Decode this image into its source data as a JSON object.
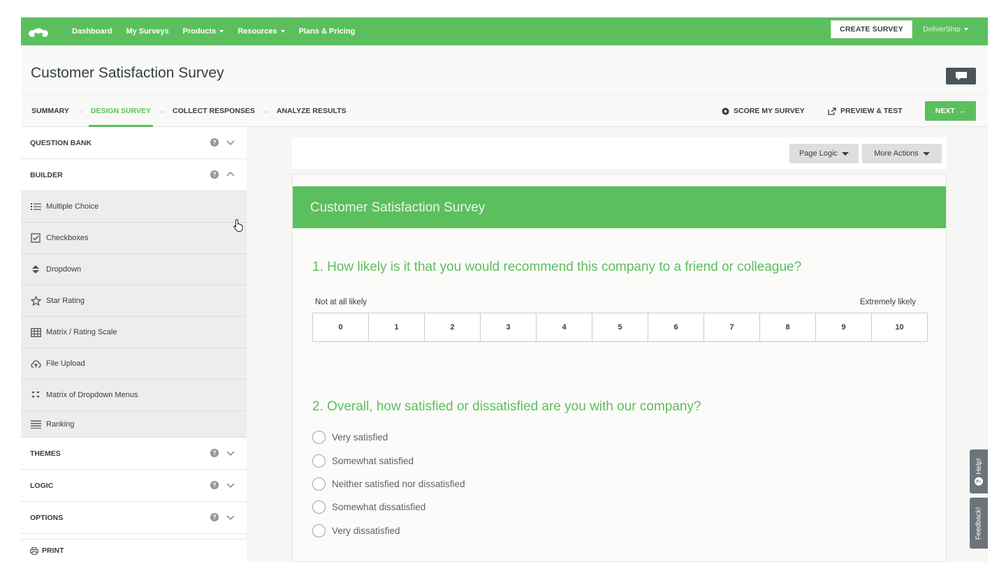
{
  "colors": {
    "brand": "#5cbf5d",
    "text": "#333e48",
    "muted": "#5a646c"
  },
  "nav": {
    "logo_icon": "surveymonkey-logo-icon",
    "links": [
      "Dashboard",
      "My Surveys",
      "Products",
      "Resources",
      "Plans & Pricing"
    ],
    "create_label": "CREATE SURVEY",
    "account": "DeliverShip"
  },
  "title": "Customer Satisfaction Survey",
  "steps": [
    "SUMMARY",
    "DESIGN SURVEY",
    "COLLECT RESPONSES",
    "ANALYZE RESULTS"
  ],
  "active_step": "DESIGN SURVEY",
  "actions": {
    "score": "SCORE MY SURVEY",
    "preview": "PREVIEW & TEST",
    "next": "NEXT"
  },
  "sidebar": {
    "question_bank": "QUESTION BANK",
    "builder": "BUILDER",
    "builder_items": [
      {
        "label": "Multiple Choice",
        "icon": "list-icon"
      },
      {
        "label": "Checkboxes",
        "icon": "checkbox-icon"
      },
      {
        "label": "Dropdown",
        "icon": "dropdown-icon"
      },
      {
        "label": "Star Rating",
        "icon": "star-icon"
      },
      {
        "label": "Matrix / Rating Scale",
        "icon": "grid-icon"
      },
      {
        "label": "File Upload",
        "icon": "cloud-upload-icon"
      },
      {
        "label": "Matrix of Dropdown Menus",
        "icon": "matrix-dropdown-icon"
      },
      {
        "label": "Ranking",
        "icon": "ranking-icon"
      }
    ],
    "themes": "THEMES",
    "logic": "LOGIC",
    "options": "OPTIONS",
    "print": "PRINT"
  },
  "toolbar": {
    "page_logic": "Page Logic",
    "more_actions": "More Actions"
  },
  "survey": {
    "header_title": "Customer Satisfaction Survey",
    "q1": {
      "text": "1. How likely is it that you would recommend this company to a friend or colleague?",
      "low_label": "Not at all likely",
      "high_label": "Extremely likely",
      "scale": [
        "0",
        "1",
        "2",
        "3",
        "4",
        "5",
        "6",
        "7",
        "8",
        "9",
        "10"
      ]
    },
    "q2": {
      "text": "2. Overall, how satisfied or dissatisfied are you with our company?",
      "choices": [
        "Very satisfied",
        "Somewhat satisfied",
        "Neither satisfied nor dissatisfied",
        "Somewhat dissatisfied",
        "Very dissatisfied"
      ]
    }
  },
  "side_tabs": {
    "help": "Help!",
    "feedback": "Feedback!"
  }
}
